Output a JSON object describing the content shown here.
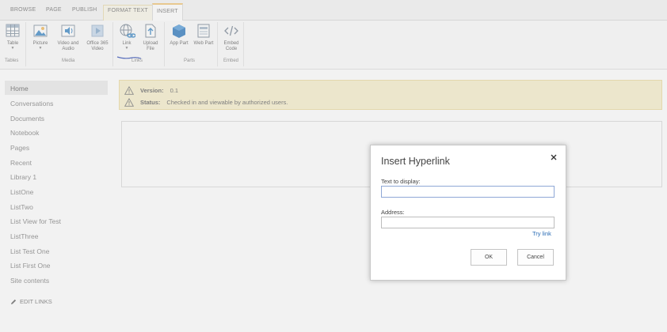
{
  "ribbon": {
    "tabs": [
      "BROWSE",
      "PAGE",
      "PUBLISH",
      "FORMAT TEXT",
      "INSERT"
    ],
    "active_tab": "INSERT",
    "buttons": {
      "table": "Table",
      "picture": "Picture",
      "video_audio": "Video and Audio",
      "office365_video": "Office 365 Video",
      "link": "Link",
      "upload_file": "Upload File",
      "app_part": "App Part",
      "web_part": "Web Part",
      "embed_code": "Embed Code"
    },
    "groups": {
      "tables": "Tables",
      "media": "Media",
      "links": "Links",
      "parts": "Parts",
      "embed": "Embed"
    }
  },
  "nav": {
    "items": [
      "Home",
      "Conversations",
      "Documents",
      "Notebook",
      "Pages",
      "Recent",
      "Library 1",
      "ListOne",
      "ListTwo",
      "List View for Test",
      "ListThree",
      "List Test One",
      "List First One",
      "Site contents"
    ],
    "selected": "Home",
    "edit_links": "EDIT LINKS"
  },
  "status": {
    "version_label": "Version:",
    "version_value": "0.1",
    "status_label": "Status:",
    "status_value": "Checked in and viewable by authorized users."
  },
  "dialog": {
    "title": "Insert Hyperlink",
    "text_label": "Text to display:",
    "text_value": "",
    "address_label": "Address:",
    "address_value": "",
    "try_link": "Try link",
    "ok": "OK",
    "cancel": "Cancel"
  },
  "colors": {
    "active_tab_accent": "#f0c26e",
    "status_bg": "#f6eec8",
    "link_blue": "#2a6cb5",
    "ribbon_icon_blue": "#2f7fc1"
  }
}
